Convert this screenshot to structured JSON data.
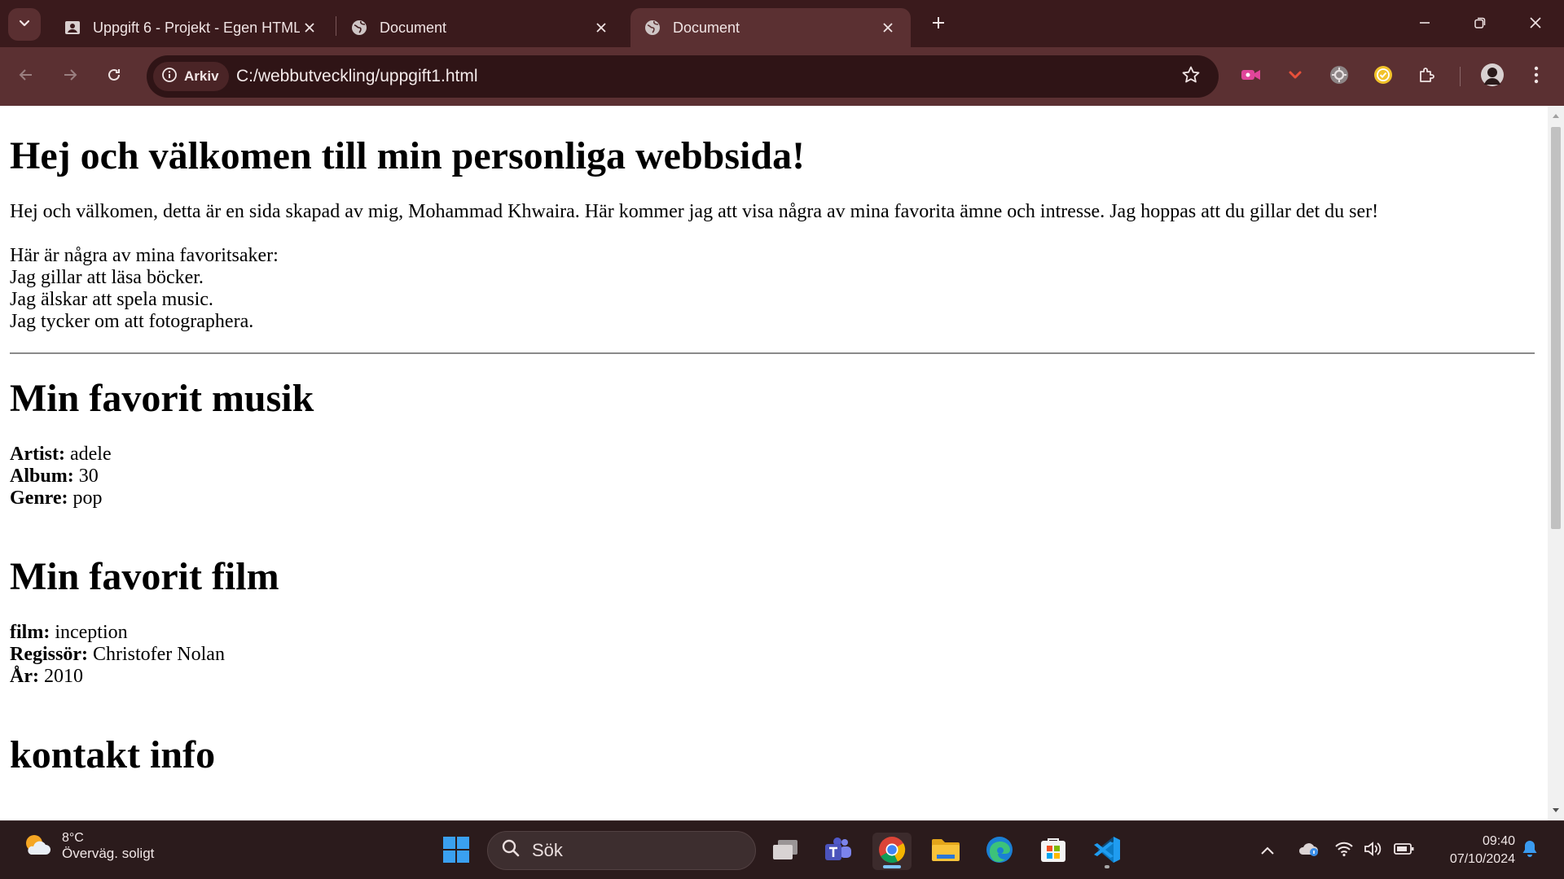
{
  "browser": {
    "tabs": [
      {
        "title": "Uppgift 6 - Projekt - Egen HTML",
        "favicon": "classroom-icon",
        "active": false
      },
      {
        "title": "Document",
        "favicon": "globe-icon",
        "active": false
      },
      {
        "title": "Document",
        "favicon": "globe-icon",
        "active": true
      }
    ],
    "site_chip": "Arkiv",
    "url": "C:/webbutveckling/uppgift1.html",
    "colors": {
      "frame": "#3a1a1c",
      "toolbar": "#5b3032",
      "omnibox": "#2f1416"
    }
  },
  "page": {
    "heading": "Hej och välkomen till min personliga webbsida!",
    "intro": "Hej och välkomen, detta är en sida skapad av mig, Mohammad Khwaira. Här kommer jag att visa några av mina favorita ämne och intresse. Jag hoppas att du gillar det du ser!",
    "favorites_title": "Här är några av mina favoritsaker:",
    "favorites": [
      "Jag gillar att läsa böcker.",
      "Jag älskar att spela music.",
      "Jag tycker om att fotographera."
    ],
    "music": {
      "heading": "Min favorit musik",
      "rows": [
        {
          "label": "Artist:",
          "value": "adele"
        },
        {
          "label": "Album:",
          "value": "30"
        },
        {
          "label": "Genre:",
          "value": "pop"
        }
      ]
    },
    "film": {
      "heading": "Min favorit film",
      "rows": [
        {
          "label": "film:",
          "value": "inception"
        },
        {
          "label": "Regissör:",
          "value": "Christofer Nolan"
        },
        {
          "label": "År:",
          "value": "2010"
        }
      ]
    },
    "contact": {
      "heading": "kontakt info"
    }
  },
  "taskbar": {
    "weather_temp": "8°C",
    "weather_cond": "Överväg. soligt",
    "search_placeholder": "Sök",
    "time": "09:40",
    "date": "07/10/2024"
  }
}
